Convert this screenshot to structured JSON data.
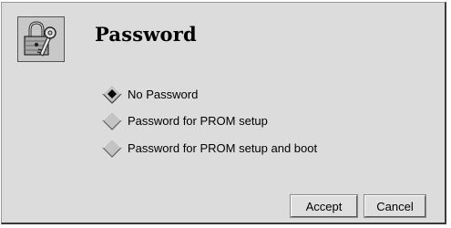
{
  "dialog": {
    "title": "Password",
    "icon": "padlock-key-icon"
  },
  "options": [
    {
      "label": "No Password",
      "selected": true
    },
    {
      "label": "Password for PROM setup",
      "selected": false
    },
    {
      "label": "Password for PROM setup and boot",
      "selected": false
    }
  ],
  "buttons": {
    "accept_label": "Accept",
    "cancel_label": "Cancel"
  },
  "colors": {
    "dialog_bg": "#dcdcdc",
    "radio_fill": "#c4c4c4",
    "radio_selected_dot": "#000000"
  }
}
